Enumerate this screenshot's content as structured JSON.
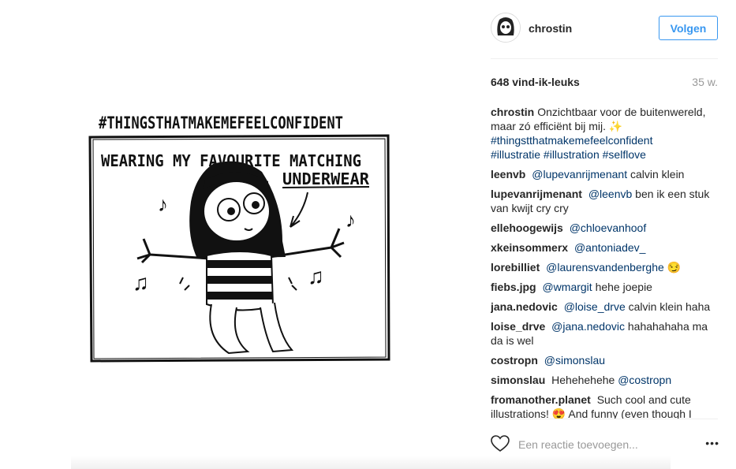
{
  "post": {
    "image_text": {
      "hashtag_title": "#THINGSTHATMAKEMEFEELCONFIDENT",
      "line1": "WEARING MY FAVOURITE MATCHING",
      "line2": "UNDERWEAR"
    },
    "author": "chrostin",
    "follow_label": "Volgen",
    "likes": "648 vind-ik-leuks",
    "age": "35 w.",
    "caption": {
      "user": "chrostin",
      "text": "Onzichtbaar voor de buitenwereld, maar zó efficiënt bij mij.",
      "emoji": "✨",
      "tags": [
        "#thingstthatmakemefeelconfident",
        "#illustratie",
        "#illustration",
        "#selflove"
      ]
    },
    "comments": [
      {
        "user": "leenvb",
        "mention": "@lupevanrijmenant",
        "text": "calvin klein"
      },
      {
        "user": "lupevanrijmenant",
        "mention": "@leenvb",
        "text": "ben ik een stuk van kwijt cry cry"
      },
      {
        "user": "ellehoogewijs",
        "mention": "@chloevanhoof",
        "text": ""
      },
      {
        "user": "xkeinsommerx",
        "mention": "@antoniadev_",
        "text": ""
      },
      {
        "user": "lorebilliet",
        "mention": "@laurensvandenberghe",
        "text": "😏"
      },
      {
        "user": "fiebs.jpg",
        "mention": "@wmargit",
        "text": "hehe joepie"
      },
      {
        "user": "jana.nedovic",
        "mention": "@loise_drve",
        "text": "calvin klein haha"
      },
      {
        "user": "loise_drve",
        "mention": "@jana.nedovic",
        "text": "hahahahaha ma da is wel"
      },
      {
        "user": "costropn",
        "mention": "@simonslau",
        "text": ""
      },
      {
        "user": "simonslau",
        "text": "Hehehehehe",
        "mention": "@costropn"
      },
      {
        "user": "fromanother.planet",
        "mention": "",
        "text": "Such cool and cute illustrations! 😍 And funny (even though I"
      }
    ],
    "add_comment_placeholder": "Een reactie toevoegen...",
    "more_label": "•••"
  }
}
